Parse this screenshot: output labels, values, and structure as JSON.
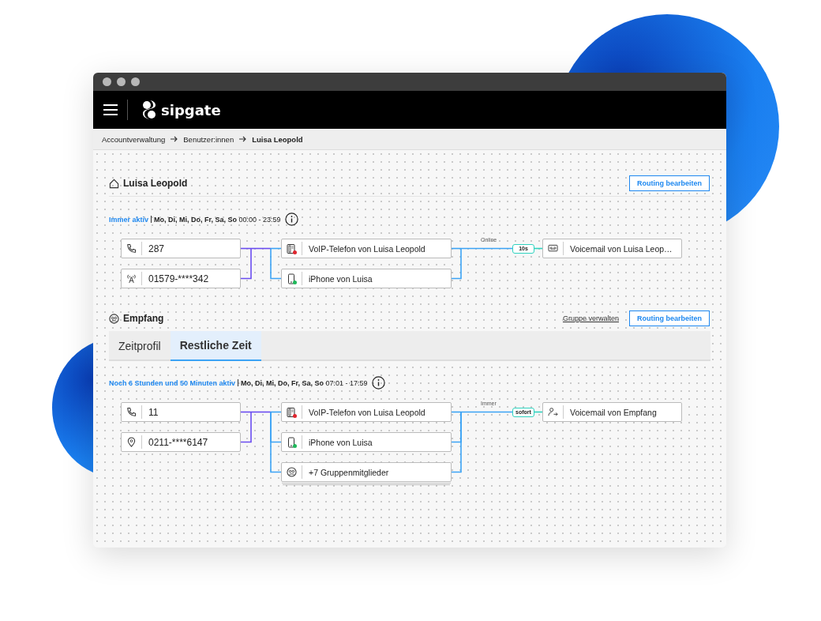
{
  "header": {
    "logo": "sipgate"
  },
  "breadcrumb": [
    {
      "label": "Accountverwaltung",
      "current": false
    },
    {
      "label": "Benutzer:innen",
      "current": false
    },
    {
      "label": "Luisa Leopold",
      "current": true
    }
  ],
  "sections": [
    {
      "kind": "user",
      "title": "Luisa Leopold",
      "button": "Routing bearbeiten",
      "schedule": {
        "status": "Immer aktiv",
        "days": "Mo, Di, Mi, Do, Fr, Sa, So",
        "time": "00:00 - 23:59"
      },
      "sources": [
        {
          "kind": "landline",
          "number": "287"
        },
        {
          "kind": "mobile",
          "number": "01579-****342"
        }
      ],
      "targets": [
        {
          "kind": "desk-phone",
          "label": "VoIP-Telefon von Luisa Leopold",
          "color": "#e0262f"
        },
        {
          "kind": "mobile",
          "label": "iPhone von Luisa",
          "color": "#1fb85a"
        }
      ],
      "condition": "Online",
      "delay": "10s",
      "fallback": {
        "kind": "voicemail",
        "label": "Voicemail von Luisa Leop…"
      }
    },
    {
      "kind": "group",
      "title": "Empfang",
      "link": "Gruppe verwalten",
      "button": "Routing bearbeiten",
      "tabs": [
        {
          "label": "Zeitprofil",
          "selected": false
        },
        {
          "label": "Restliche Zeit",
          "selected": true
        }
      ],
      "schedule": {
        "status": "Noch 6 Stunden und 50 Minuten aktiv",
        "days": "Mo, Di, Mi, Do, Fr, Sa, So",
        "time": "07:01 - 17:59"
      },
      "sources": [
        {
          "kind": "landline",
          "number": "11"
        },
        {
          "kind": "location",
          "number": "0211-****6147"
        }
      ],
      "targets": [
        {
          "kind": "desk-phone",
          "label": "VoIP-Telefon von Luisa Leopold",
          "color": "#e0262f"
        },
        {
          "kind": "mobile",
          "label": "iPhone von Luisa",
          "color": "#1fb85a"
        },
        {
          "kind": "group",
          "label": "+7 Gruppenmitglieder"
        }
      ],
      "condition": "Immer",
      "delay": "sofort",
      "fallback": {
        "kind": "forward",
        "label": "Voicemail von Empfang"
      }
    }
  ]
}
